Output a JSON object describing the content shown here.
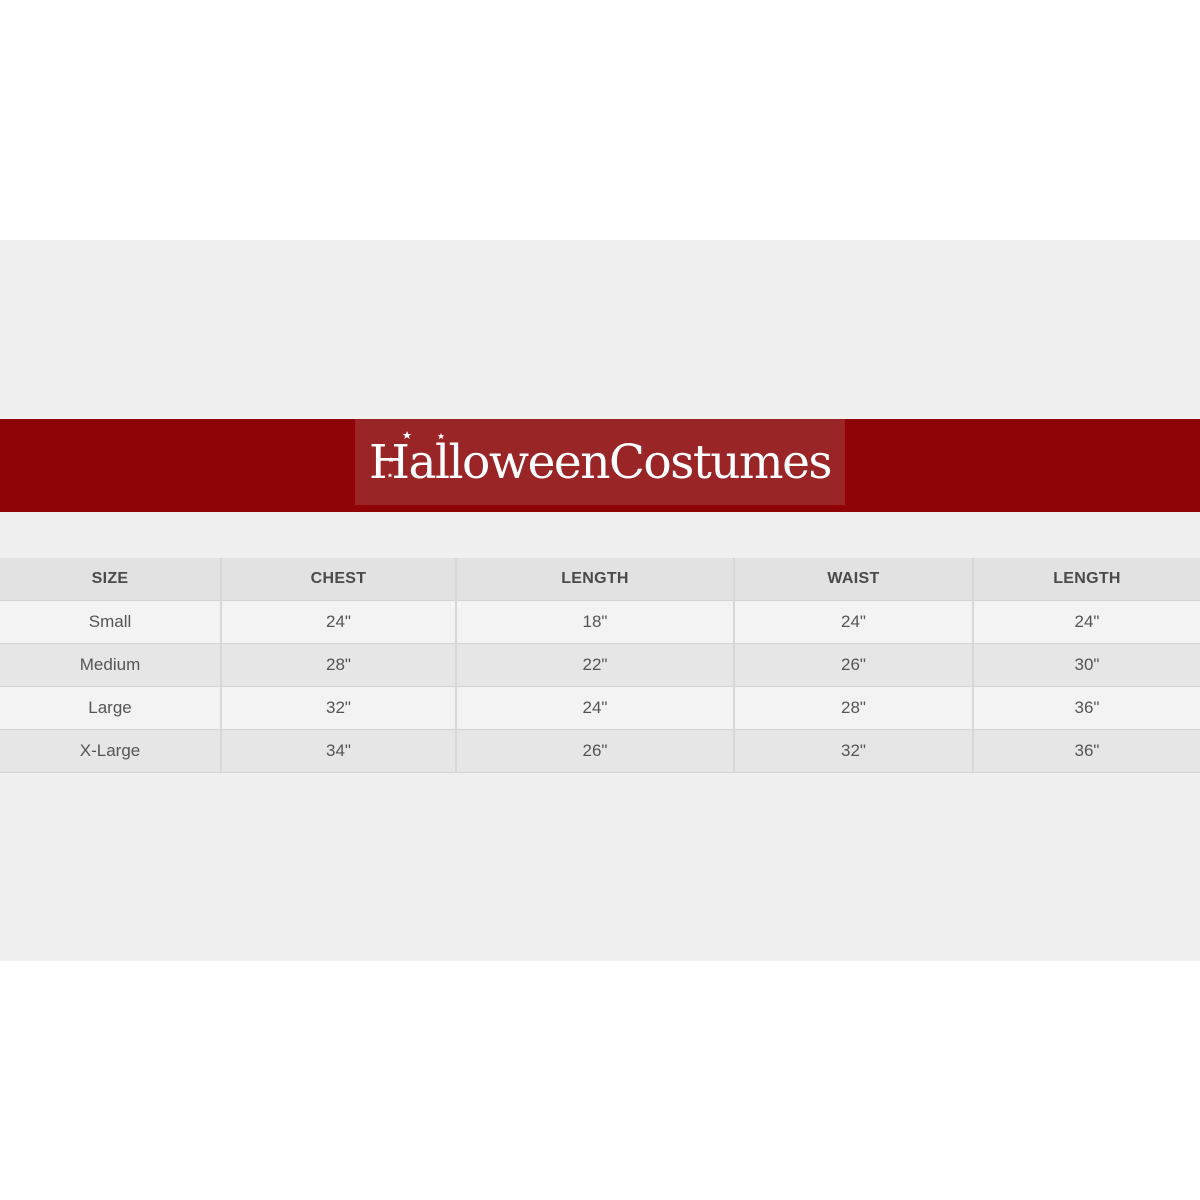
{
  "brand": {
    "logo_text": "HalloweenCostumes",
    "banner_color": "#8e0406",
    "logo_box_color": "#9a2527"
  },
  "size_chart": {
    "headers": [
      "SIZE",
      "CHEST",
      "LENGTH",
      "WAIST",
      "LENGTH"
    ],
    "rows": [
      [
        "Small",
        "24\"",
        "18\"",
        "24\"",
        "24\""
      ],
      [
        "Medium",
        "28\"",
        "22\"",
        "26\"",
        "30\""
      ],
      [
        "Large",
        "32\"",
        "24\"",
        "28\"",
        "36\""
      ],
      [
        "X-Large",
        "34\"",
        "26\"",
        "32\"",
        "36\""
      ]
    ]
  }
}
